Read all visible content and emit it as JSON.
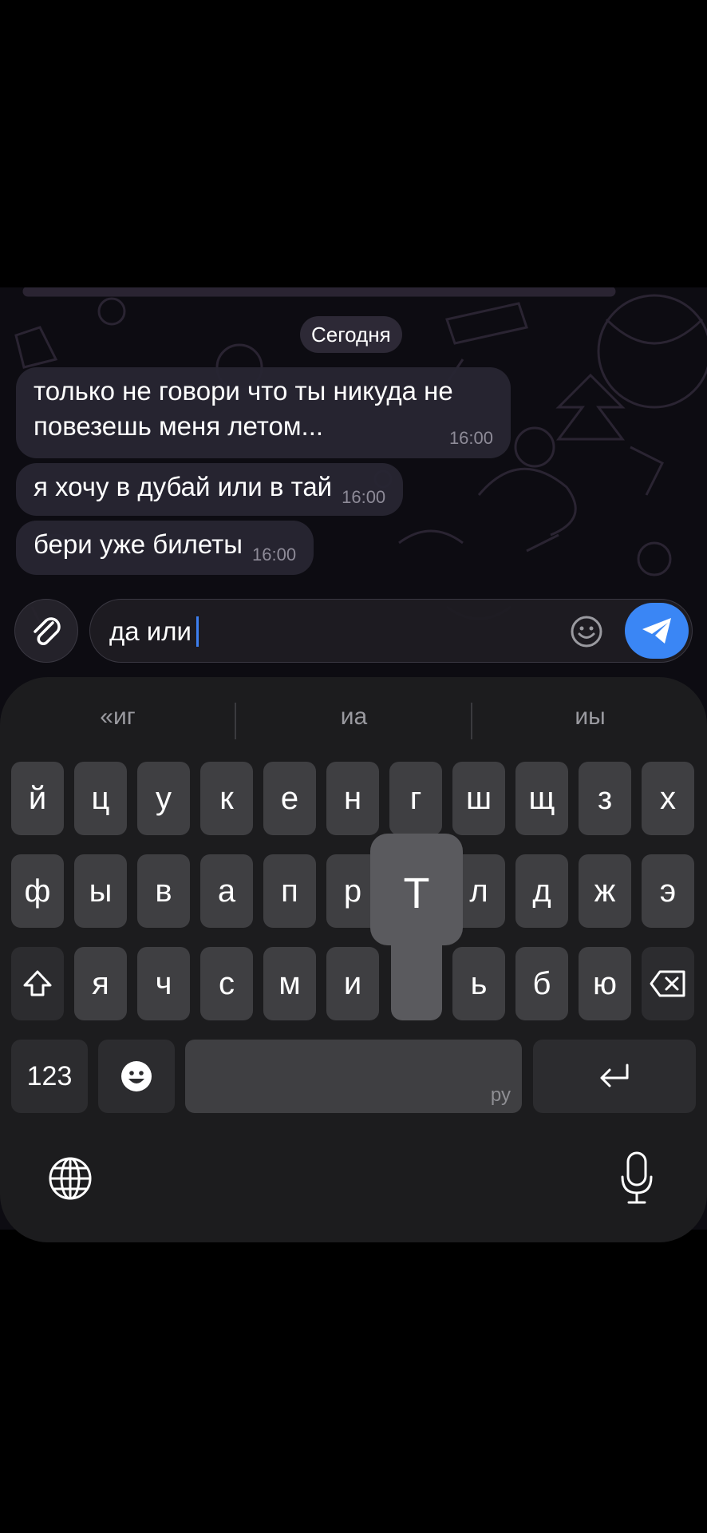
{
  "chat": {
    "date_label": "Сегодня",
    "messages": [
      {
        "text_line1": "только не говори что ты никуда не",
        "text_line2": "повезешь меня летом...",
        "time": "16:00"
      },
      {
        "text": "я хочу в дубай или в тай",
        "time": "16:00"
      },
      {
        "text": "бери уже билеты",
        "time": "16:00"
      }
    ]
  },
  "composer": {
    "input_value": "да или",
    "attach_icon": "paperclip-icon",
    "emoji_icon": "smiley-icon",
    "send_icon": "paper-plane-icon",
    "send_color": "#3a86f5"
  },
  "keyboard": {
    "suggestions": [
      "«иг",
      "иа",
      "иы"
    ],
    "row1": [
      "й",
      "ц",
      "у",
      "к",
      "е",
      "н",
      "г",
      "ш",
      "щ",
      "з",
      "х"
    ],
    "row2": [
      "ф",
      "ы",
      "в",
      "а",
      "п",
      "р",
      "т",
      "л",
      "д",
      "ж",
      "э"
    ],
    "row3": [
      "я",
      "ч",
      "с",
      "м",
      "и",
      "ь",
      "б",
      "ю"
    ],
    "popup_key": "Т",
    "numbers_label": "123",
    "space_label": "ру",
    "shift_icon": "shift-icon",
    "backspace_icon": "backspace-icon",
    "emoji_key_icon": "emoji-icon",
    "return_icon": "return-icon",
    "globe_icon": "globe-icon",
    "mic_icon": "microphone-icon"
  }
}
